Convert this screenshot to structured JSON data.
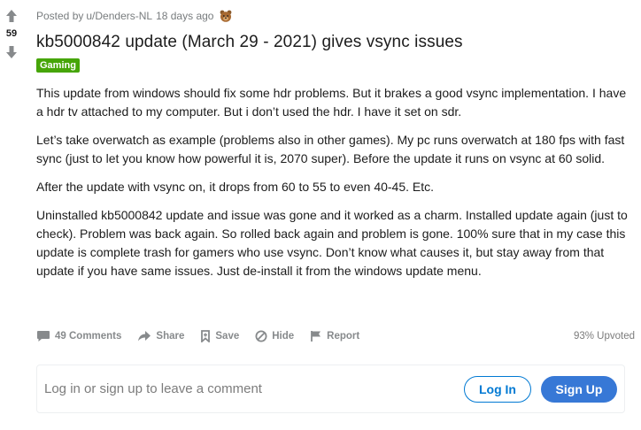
{
  "vote": {
    "count": "59"
  },
  "post": {
    "posted_by_prefix": "Posted by",
    "author": "u/Denders-NL",
    "time": "18 days ago",
    "award_icon": "bear-award-icon",
    "title": "kb5000842 update (March 29 - 2021) gives vsync issues",
    "flair": "Gaming",
    "flair_color": "#46a508",
    "paragraphs": [
      "This update from windows should fix some hdr problems. But it brakes a good vsync implementation. I have a hdr tv attached to my computer. But i don’t used the hdr. I have it set on sdr.",
      "Let’s take overwatch as example (problems also in other games). My pc runs overwatch at 180 fps with fast sync (just to let you know how powerful it is, 2070 super). Before the update it runs on vsync at 60 solid.",
      "After the update with vsync on, it drops from 60 to 55 to even 40-45. Etc.",
      "Uninstalled kb5000842 update and issue was gone and it worked as a charm. Installed update again (just to check). Problem was back again. So rolled back again and problem is gone. 100% sure that in my case this update is complete trash for gamers who use vsync. Don’t know what causes it, but stay away from that update if you have same issues. Just de-install it from the windows update menu."
    ]
  },
  "actions": {
    "comments": "49 Comments",
    "share": "Share",
    "save": "Save",
    "hide": "Hide",
    "report": "Report",
    "upvoted": "93% Upvoted"
  },
  "comment_box": {
    "prompt": "Log in or sign up to leave a comment",
    "login": "Log In",
    "signup": "Sign Up",
    "accent": "#0079d3"
  }
}
